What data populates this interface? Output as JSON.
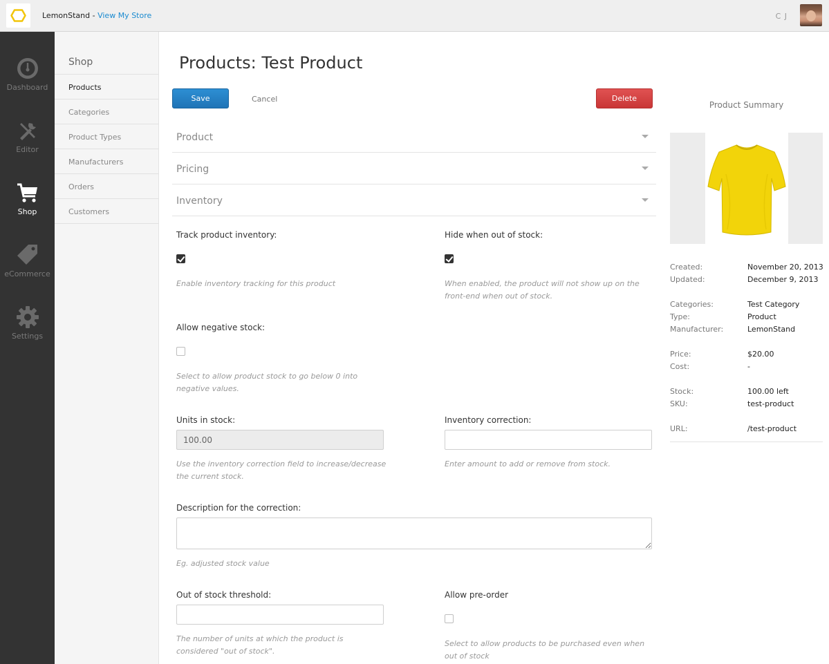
{
  "topbar": {
    "store_name": "LemonStand",
    "separator": " - ",
    "view_store_link": "View My Store",
    "user_initials": "C J"
  },
  "leftnav": {
    "items": [
      {
        "label": "Dashboard",
        "icon": "dashboard-gauge-icon"
      },
      {
        "label": "Editor",
        "icon": "editor-tools-icon"
      },
      {
        "label": "Shop",
        "icon": "shopping-cart-icon"
      },
      {
        "label": "eCommerce",
        "icon": "price-tag-icon"
      },
      {
        "label": "Settings",
        "icon": "gear-icon"
      }
    ],
    "active": "Shop"
  },
  "subnav": {
    "title": "Shop",
    "items": [
      "Products",
      "Categories",
      "Product Types",
      "Manufacturers",
      "Orders",
      "Customers"
    ],
    "active": "Products"
  },
  "page": {
    "title": "Products: Test Product",
    "save_label": "Save",
    "cancel_label": "Cancel",
    "delete_label": "Delete"
  },
  "sections": [
    {
      "label": "Product"
    },
    {
      "label": "Pricing"
    },
    {
      "label": "Inventory"
    }
  ],
  "inventory": {
    "track_label": "Track product inventory:",
    "track_checked": true,
    "track_help": "Enable inventory tracking for this product",
    "hide_label": "Hide when out of stock:",
    "hide_checked": true,
    "hide_help_1": "When enabled, the product will not show up on the",
    "hide_help_2": "front-end when out of stock.",
    "negative_label": "Allow negative stock:",
    "negative_checked": false,
    "negative_help_1": "Select to allow product stock to go below 0 into",
    "negative_help_2": "negative values.",
    "units_label": "Units in stock:",
    "units_value": "100.00",
    "units_help_1": "Use the inventory correction field to increase/decrease",
    "units_help_2": "the current stock.",
    "correction_label": "Inventory correction:",
    "correction_value": "",
    "correction_help": "Enter amount to add or remove from stock.",
    "description_label": "Description for the correction:",
    "description_help": "Eg. adjusted stock value",
    "threshold_label": "Out of stock threshold:",
    "threshold_value": "",
    "threshold_help_1": "The number of units at which the product is",
    "threshold_help_2": "considered \"out of stock\".",
    "preorder_label": "Allow pre-order",
    "preorder_checked": false,
    "preorder_help_1": "Select to allow products to be purchased even when",
    "preorder_help_2": "out of stock"
  },
  "summary": {
    "title": "Product Summary",
    "image_icon": "yellow-tshirt-image",
    "fields": [
      {
        "key": "Created:",
        "value": "November 20, 2013"
      },
      {
        "key": "Updated:",
        "value": "December 9, 2013"
      },
      {
        "key": "Categories:",
        "value": "Test Category"
      },
      {
        "key": "Type:",
        "value": "Product"
      },
      {
        "key": "Manufacturer:",
        "value": "LemonStand"
      },
      {
        "key": "Price:",
        "value": "$20.00"
      },
      {
        "key": "Cost:",
        "value": "-"
      },
      {
        "key": "Stock:",
        "value": "100.00 left"
      },
      {
        "key": "SKU:",
        "value": "test-product"
      },
      {
        "key": "URL:",
        "value": "/test-product"
      }
    ]
  },
  "colors": {
    "accent": "#1a8ad0",
    "save": "#1f74b6",
    "delete": "#c93636",
    "sidebar": "#333333",
    "product": "#f2d40a"
  }
}
